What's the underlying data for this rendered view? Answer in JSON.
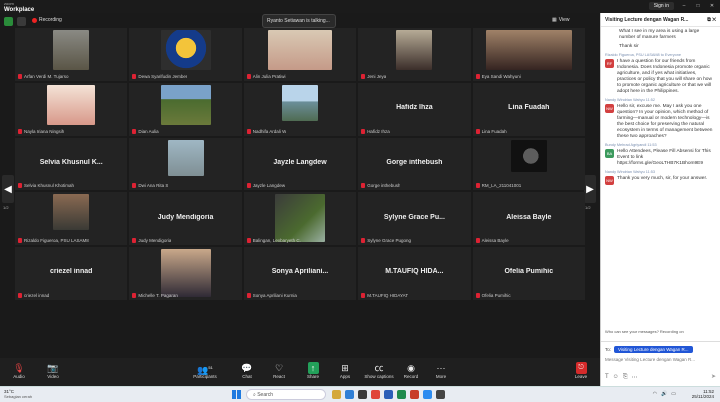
{
  "window": {
    "brand_top": "zoom",
    "brand": "Workplace",
    "sign_in": "Sign in"
  },
  "meeting": {
    "recording": "Recording",
    "view": "View",
    "talking": "Ryanto Setiawan is talking..."
  },
  "grid": {
    "page_left": "1/2",
    "page_right": "1/2",
    "tiles": [
      {
        "name": "Arfan Verdi M. Tujarso",
        "label": "",
        "video": "v1"
      },
      {
        "name": "Dewa Syarifudin Jember",
        "label": "",
        "video": "v2"
      },
      {
        "name": "Alin Julia Pratiwi",
        "label": "",
        "video": "v3"
      },
      {
        "name": "Jeni Jeya",
        "label": "",
        "video": "v4"
      },
      {
        "name": "Eya Sandi Wahyuni",
        "label": "",
        "video": "v5"
      },
      {
        "name": "Nayla Iriana Ningsih",
        "label": "",
        "video": "v6"
      },
      {
        "name": "Dian Aulia",
        "label": "",
        "video": "v7"
      },
      {
        "name": "Nadhifa Ardali W",
        "label": "",
        "video": "v8"
      },
      {
        "name": "Hafidz Ihza",
        "label": "Hafidz Ihza",
        "video": ""
      },
      {
        "name": "Lina Fuadah",
        "label": "Lina Fuadah",
        "video": ""
      },
      {
        "name": "Selvia Khusnul Khotimah",
        "label": "Selvia Khusnul K...",
        "video": ""
      },
      {
        "name": "Dwi Ana Rita S",
        "label": "",
        "video": "v9"
      },
      {
        "name": "Jayzle Langdew",
        "label": "Jayzle Langdew",
        "video": ""
      },
      {
        "name": "Gorge inthebush",
        "label": "Gorge inthebush",
        "video": ""
      },
      {
        "name": "RM_LA_211041001",
        "label": "",
        "video": "v10"
      },
      {
        "name": "Rizaldo Figueroa, PSU LASAM8",
        "label": "",
        "video": "v11"
      },
      {
        "name": "Judy Mendigoria",
        "label": "Judy Mendigoria",
        "video": ""
      },
      {
        "name": "Balingan, Lexbaryeth C.",
        "label": "",
        "video": "v12"
      },
      {
        "name": "Sylyne Grace Pugong",
        "label": "Sylyne Grace Pu...",
        "video": ""
      },
      {
        "name": "Aleissa Bayle",
        "label": "Aleissa Bayle",
        "video": ""
      },
      {
        "name": "criezel innad",
        "label": "criezel innad",
        "video": ""
      },
      {
        "name": "Michelle T. Pagaran",
        "label": "",
        "video": "v13"
      },
      {
        "name": "Sonya Apriliani Kurnia",
        "label": "Sonya Apriliani...",
        "video": ""
      },
      {
        "name": "M.TAUFIQ HIDAYAT",
        "label": "M.TAUFIQ HIDA...",
        "video": ""
      },
      {
        "name": "Ofelia Pumihic",
        "label": "Ofelia Pumihic",
        "video": ""
      }
    ]
  },
  "toolbar": {
    "audio": "Audio",
    "video": "Video",
    "participants": "Participants",
    "participants_count": "51",
    "chat": "Chat",
    "react": "React",
    "share": "Share",
    "apps": "Apps",
    "show_captions": "Show captions",
    "record": "Record",
    "more": "More",
    "leave": "Leave"
  },
  "chat": {
    "title": "Visiting Lecture dengan Wagan R...",
    "messages": [
      {
        "type": "text",
        "text": "What I see in my area is using a large number of manure farmers"
      },
      {
        "type": "text",
        "text": "Thank sir"
      },
      {
        "type": "meta",
        "text": "Rizaldo Figueroa, PSU LASAM8 to Everyone"
      },
      {
        "type": "msg",
        "avatar": "RF",
        "color": "red",
        "text": "I have a question for our friends from Indonesia. Does Indonesia promote organic agriculture, and if yes what initiatives, practices or policy that you will share on how to promote organic agriculture or that we will adopt here in the Philippines."
      },
      {
        "type": "meta",
        "text": "Nandy Windrian Wahyu 11:52"
      },
      {
        "type": "msg",
        "avatar": "NW",
        "color": "red",
        "text": "Hello sir, excuse me. May I ask you one question? In your opinion, which method of farming—manual or modern technology—is the best choice for preserving the natural ecosystem in terms of management between these two approaches?"
      },
      {
        "type": "meta",
        "text": "Bundy Mehrad Agriyandi 11:53"
      },
      {
        "type": "msg",
        "avatar": "BA",
        "color": "green",
        "text": "Hello Attendees, Please Fill Absensi for This Event to link https://forms.gle/GeoLTHB7K1Bhom9E9"
      },
      {
        "type": "meta",
        "text": "Nandy Windrian Wahyu 11:53"
      },
      {
        "type": "msg",
        "avatar": "NW",
        "color": "red",
        "text": "Thank you very much, sir, for your answer."
      }
    ],
    "who_can_see": "Who can see your messages? Recording on",
    "to_label": "To:",
    "to_target": "Visiting Lecture dengan Wagan R...",
    "placeholder": "Message Visiting Lecture dengan Wagan R..."
  },
  "taskbar": {
    "weather_temp": "31°C",
    "weather_desc": "Sebagian cerah",
    "search": "Search",
    "time": "11:52",
    "date": "25/11/2024"
  }
}
